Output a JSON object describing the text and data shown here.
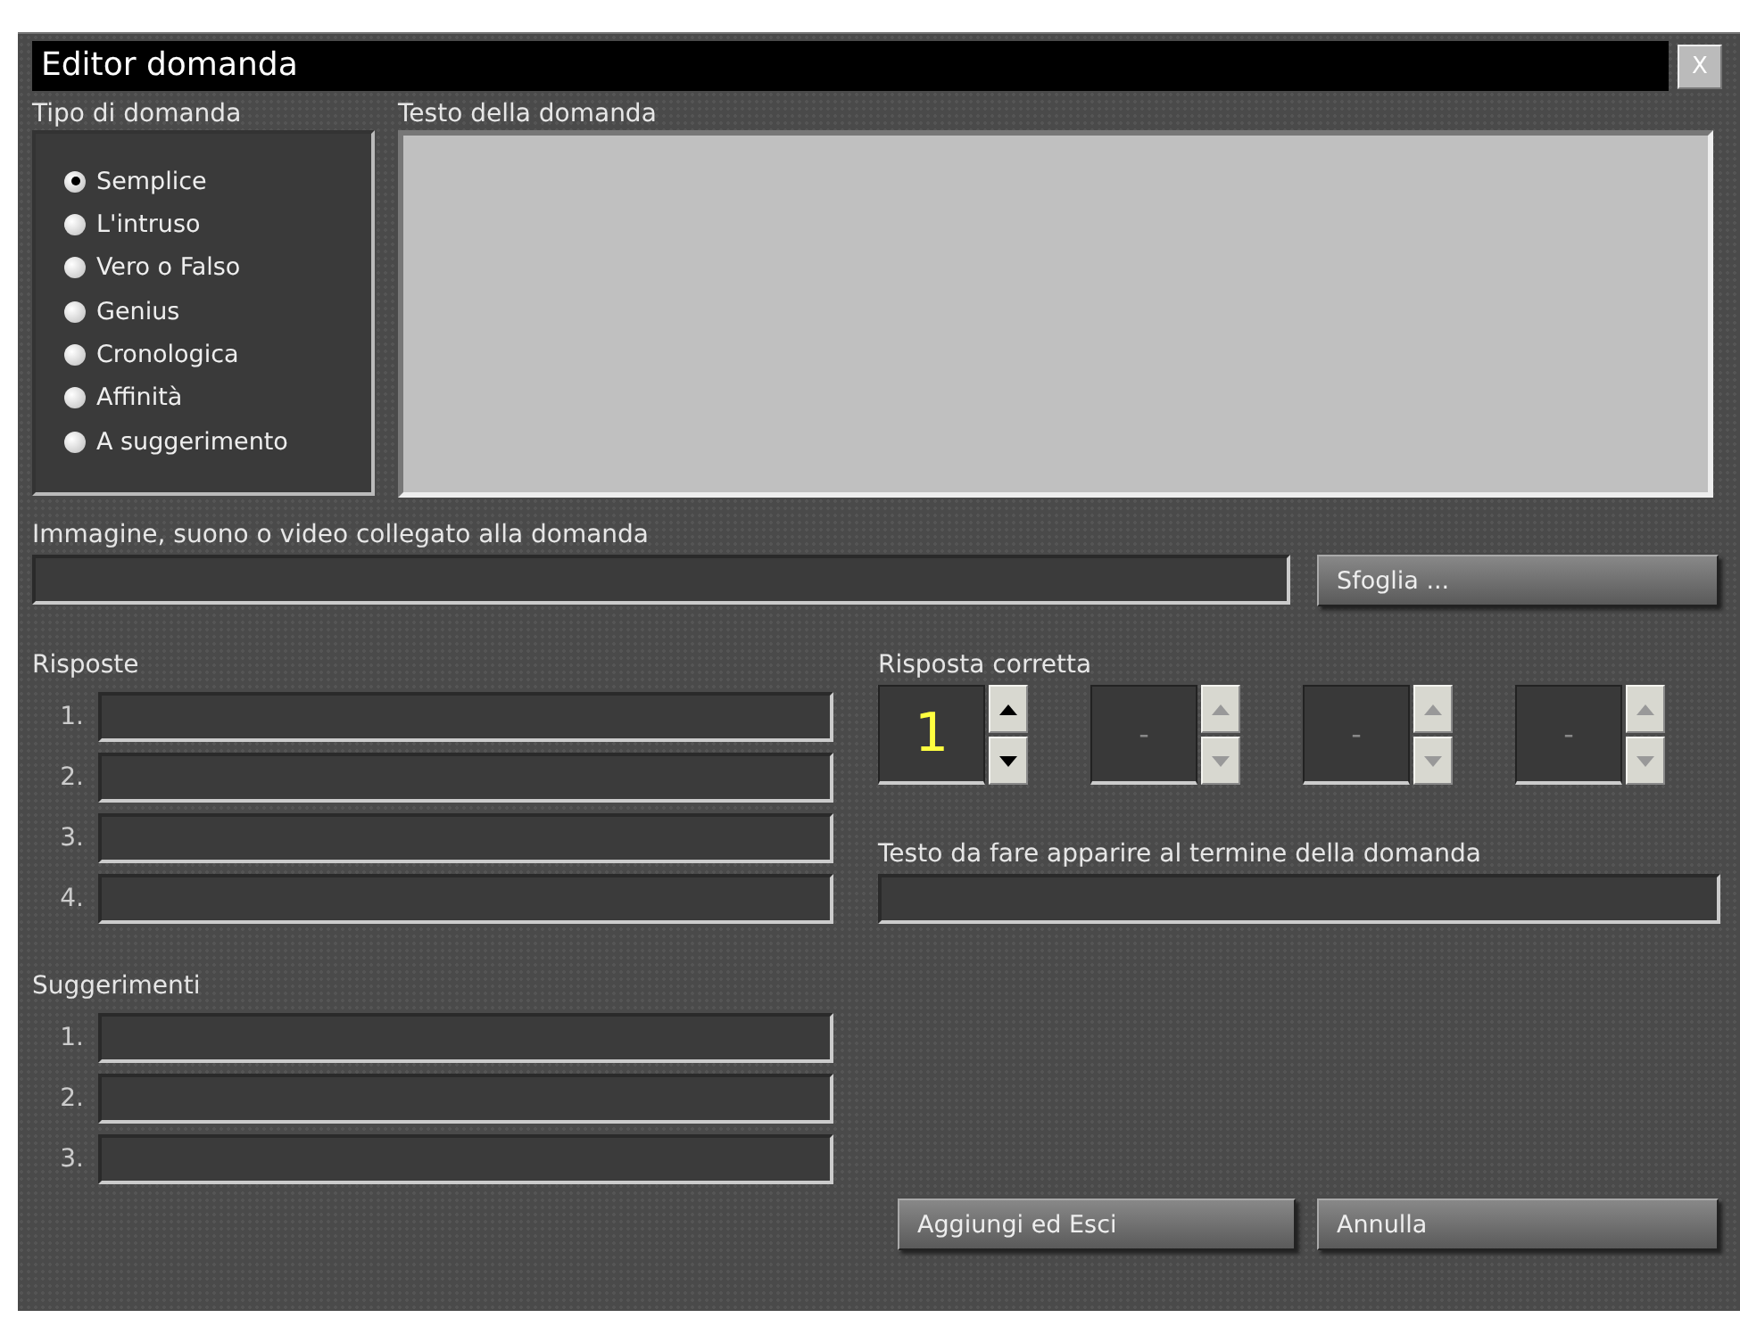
{
  "window": {
    "title": "Editor domanda",
    "close": "X"
  },
  "question_type": {
    "label": "Tipo di domanda",
    "options": [
      {
        "label": "Semplice",
        "selected": true
      },
      {
        "label": "L'intruso",
        "selected": false
      },
      {
        "label": "Vero o Falso",
        "selected": false
      },
      {
        "label": "Genius",
        "selected": false
      },
      {
        "label": "Cronologica",
        "selected": false
      },
      {
        "label": "Affinità",
        "selected": false
      },
      {
        "label": "A suggerimento",
        "selected": false
      }
    ]
  },
  "question_text": {
    "label": "Testo della domanda"
  },
  "media": {
    "label": "Immagine, suono o video collegato alla domanda",
    "browse_button": "Sfoglia ..."
  },
  "answers": {
    "label": "Risposte",
    "rows": [
      {
        "number": "1."
      },
      {
        "number": "2."
      },
      {
        "number": "3."
      },
      {
        "number": "4."
      }
    ]
  },
  "correct_answer": {
    "label": "Risposta corretta",
    "spinners": [
      {
        "value": "1",
        "disabled": false
      },
      {
        "value": "-",
        "disabled": true
      },
      {
        "value": "-",
        "disabled": true
      },
      {
        "value": "-",
        "disabled": true
      }
    ]
  },
  "end_text": {
    "label": "Testo da fare apparire al termine della domanda"
  },
  "hints": {
    "label": "Suggerimenti",
    "rows": [
      {
        "number": "1."
      },
      {
        "number": "2."
      },
      {
        "number": "3."
      }
    ]
  },
  "buttons": [
    "Aggiungi ed Esci",
    "Annulla"
  ]
}
